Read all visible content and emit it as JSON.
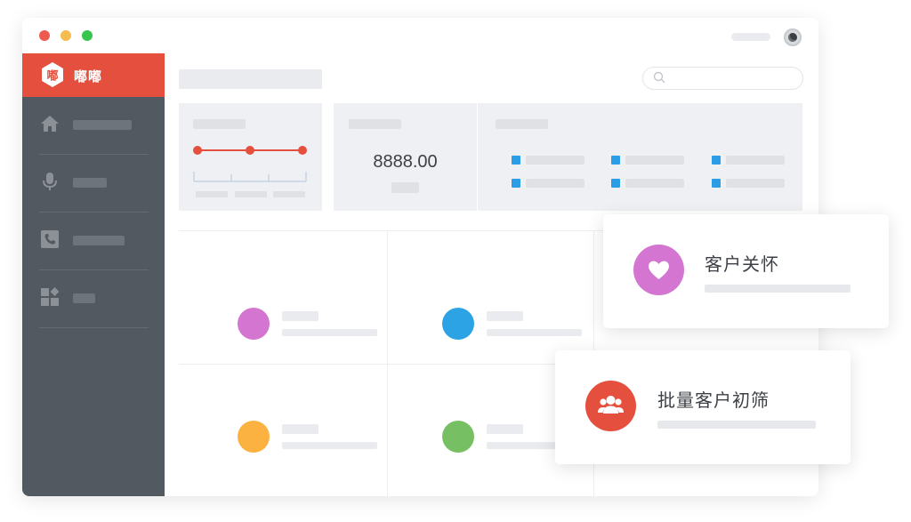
{
  "sidebar": {
    "brand": {
      "name": "嘟嘟",
      "logo_char": "嘟",
      "color": "#e5503e"
    },
    "items": [
      {
        "icon": "home-icon"
      },
      {
        "icon": "microphone-icon"
      },
      {
        "icon": "phone-book-icon"
      },
      {
        "icon": "apps-icon"
      }
    ]
  },
  "dashboard": {
    "amount": "8888.00",
    "accent": "#2b9de6"
  },
  "cards": [
    {
      "title": "客户关怀",
      "icon": "heart-icon",
      "color": "#d375d1"
    },
    {
      "title": "批量客户初筛",
      "icon": "group-icon",
      "color": "#e5503e"
    }
  ],
  "tiles": [
    {
      "color": "#d375d1"
    },
    {
      "color": "#2ba3e5"
    },
    {
      "color": "#fbb241"
    },
    {
      "color": "#76c063"
    }
  ]
}
